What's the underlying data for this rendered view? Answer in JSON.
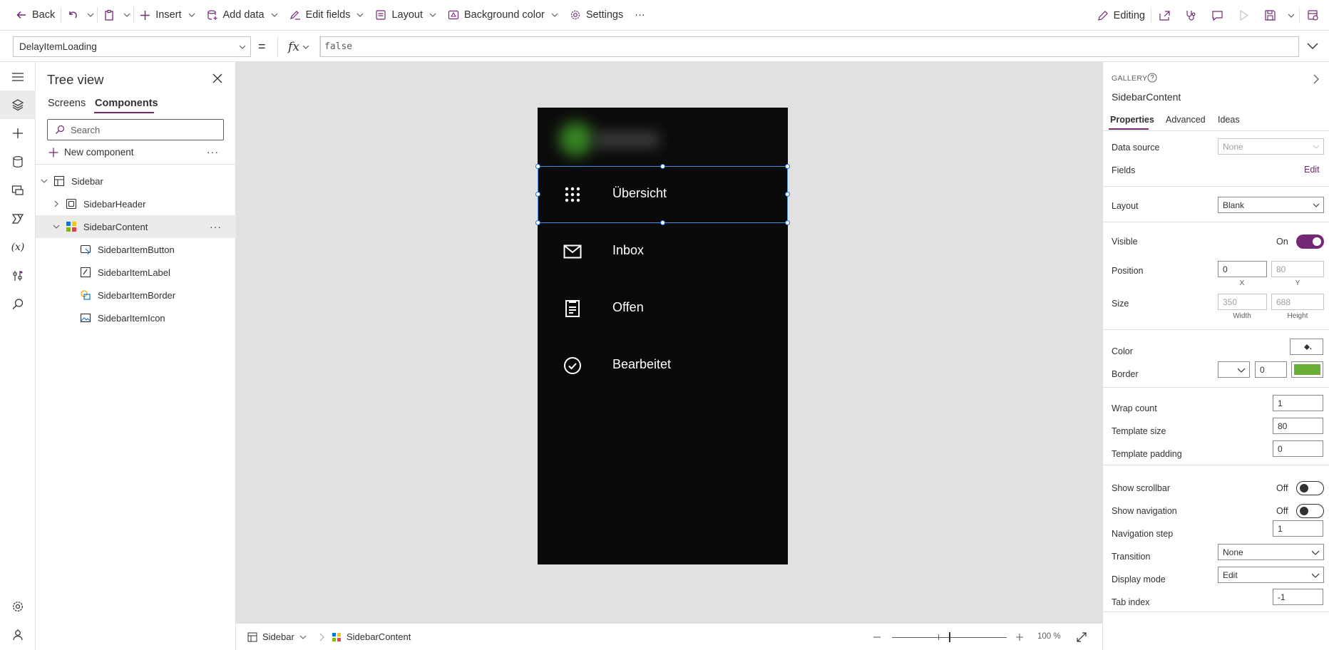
{
  "toolbar": {
    "back": "Back",
    "insert": "Insert",
    "add_data": "Add data",
    "edit_fields": "Edit fields",
    "layout": "Layout",
    "background_color": "Background color",
    "settings": "Settings",
    "more": "···",
    "editing": "Editing"
  },
  "formula_bar": {
    "property": "DelayItemLoading",
    "equals": "=",
    "fx": "fx",
    "formula": "false"
  },
  "tree": {
    "title": "Tree view",
    "tabs": [
      "Screens",
      "Components"
    ],
    "active_tab": "Components",
    "search_placeholder": "Search",
    "new_component": "New component",
    "more": "···",
    "nodes": [
      {
        "label": "Sidebar",
        "level": 0,
        "expanded": true
      },
      {
        "label": "SidebarHeader",
        "level": 1,
        "expanded": false
      },
      {
        "label": "SidebarContent",
        "level": 1,
        "expanded": true,
        "selected": true
      },
      {
        "label": "SidebarItemButton",
        "level": 2
      },
      {
        "label": "SidebarItemLabel",
        "level": 2
      },
      {
        "label": "SidebarItemBorder",
        "level": 2
      },
      {
        "label": "SidebarItemIcon",
        "level": 2
      }
    ]
  },
  "canvas": {
    "items": [
      {
        "label": "Übersicht",
        "icon": "grid-dots-icon"
      },
      {
        "label": "Inbox",
        "icon": "mail-icon"
      },
      {
        "label": "Offen",
        "icon": "clipboard-icon"
      },
      {
        "label": "Bearbeitet",
        "icon": "check-circle-icon"
      }
    ]
  },
  "status": {
    "screen": "Sidebar",
    "control": "SidebarContent",
    "zoom": "100 %"
  },
  "props": {
    "type": "GALLERY",
    "name": "SidebarContent",
    "tabs": [
      "Properties",
      "Advanced",
      "Ideas"
    ],
    "active_tab": "Properties",
    "data_source_label": "Data source",
    "data_source": "None",
    "fields_label": "Fields",
    "fields_edit": "Edit",
    "layout_label": "Layout",
    "layout": "Blank",
    "visible_label": "Visible",
    "visible": "On",
    "position_label": "Position",
    "x": "0",
    "y": "80",
    "x_sub": "X",
    "y_sub": "Y",
    "size_label": "Size",
    "width": "350",
    "height": "688",
    "width_sub": "Width",
    "height_sub": "Height",
    "color_label": "Color",
    "border_label": "Border",
    "border_width": "0",
    "border_color": "#6aaf35",
    "wrap_count_label": "Wrap count",
    "wrap_count": "1",
    "template_size_label": "Template size",
    "template_size": "80",
    "template_padding_label": "Template padding",
    "template_padding": "0",
    "show_scrollbar_label": "Show scrollbar",
    "show_scrollbar": "Off",
    "show_navigation_label": "Show navigation",
    "show_navigation": "Off",
    "navigation_step_label": "Navigation step",
    "navigation_step": "1",
    "transition_label": "Transition",
    "transition": "None",
    "display_mode_label": "Display mode",
    "display_mode": "Edit",
    "tab_index_label": "Tab index",
    "tab_index": "-1"
  },
  "colors": {
    "accent": "#742774",
    "selection": "#4a8de3",
    "canvas_bg": "#e1e1e1",
    "screen_bg": "#0a0a0a"
  }
}
